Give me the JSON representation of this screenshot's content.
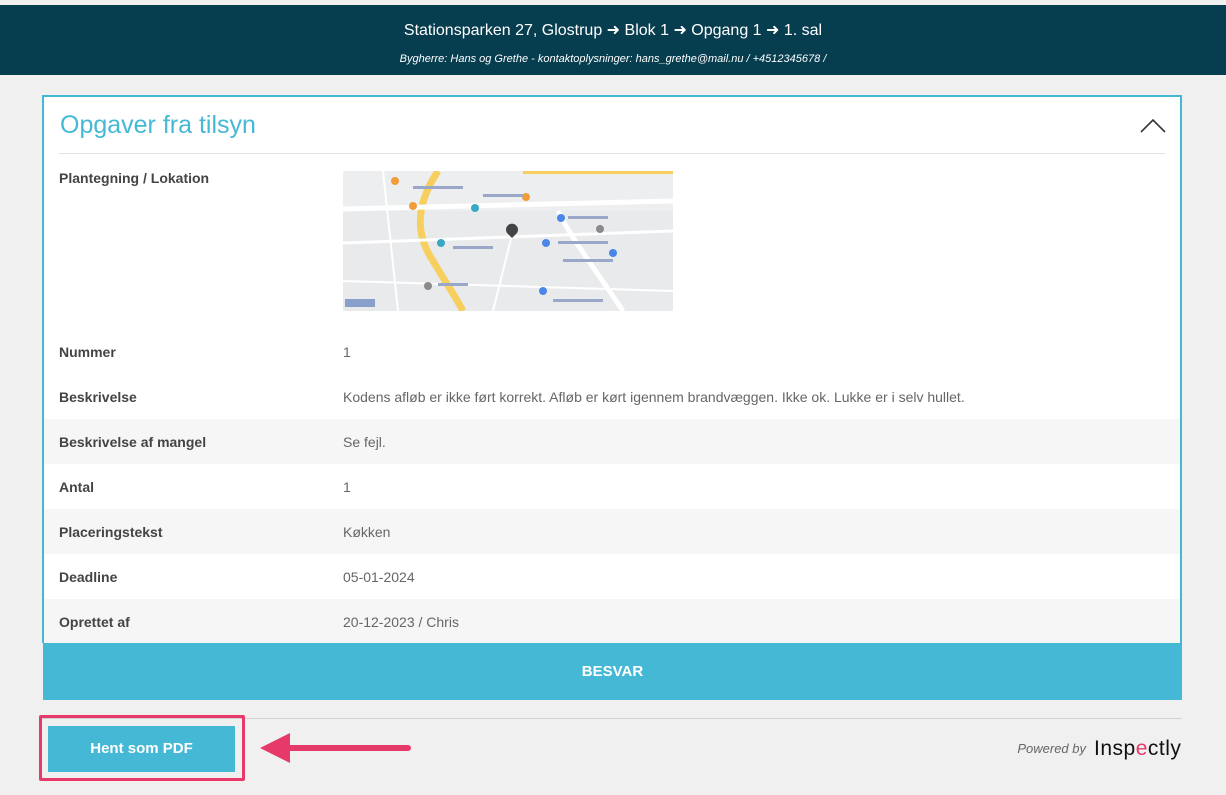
{
  "header": {
    "title": "Stationsparken 27, Glostrup ➜ Blok 1 ➜ Opgang 1 ➜ 1. sal",
    "subtitle": "Bygherre: Hans og Grethe - kontaktoplysninger: hans_grethe@mail.nu / +4512345678 /"
  },
  "card": {
    "title": "Opgaver fra tilsyn",
    "location_label": "Plantegning / Lokation",
    "rows": [
      {
        "label": "Nummer",
        "value": "1"
      },
      {
        "label": "Beskrivelse",
        "value": "Kodens afløb er ikke ført korrekt. Afløb er kørt igennem brandvæggen. Ikke ok. Lukke er i selv hullet."
      },
      {
        "label": "Beskrivelse af mangel",
        "value": "Se fejl."
      },
      {
        "label": "Antal",
        "value": "1"
      },
      {
        "label": "Placeringstekst",
        "value": "Køkken"
      },
      {
        "label": "Deadline",
        "value": "05-01-2024"
      },
      {
        "label": "Oprettet af",
        "value": "20-12-2023 / Chris"
      }
    ]
  },
  "actions": {
    "answer_label": "BESVAR",
    "pdf_label": "Hent som PDF"
  },
  "footer": {
    "powered_by": "Powered by",
    "logo_pre": "Insp",
    "logo_accent": "e",
    "logo_post": "ctly"
  },
  "colors": {
    "header_bg": "#063d4f",
    "accent": "#45b8d6",
    "highlight": "#e63a6b"
  },
  "icons": [
    "chevron-up-icon",
    "map-pin-icon",
    "arrow-left-icon"
  ]
}
